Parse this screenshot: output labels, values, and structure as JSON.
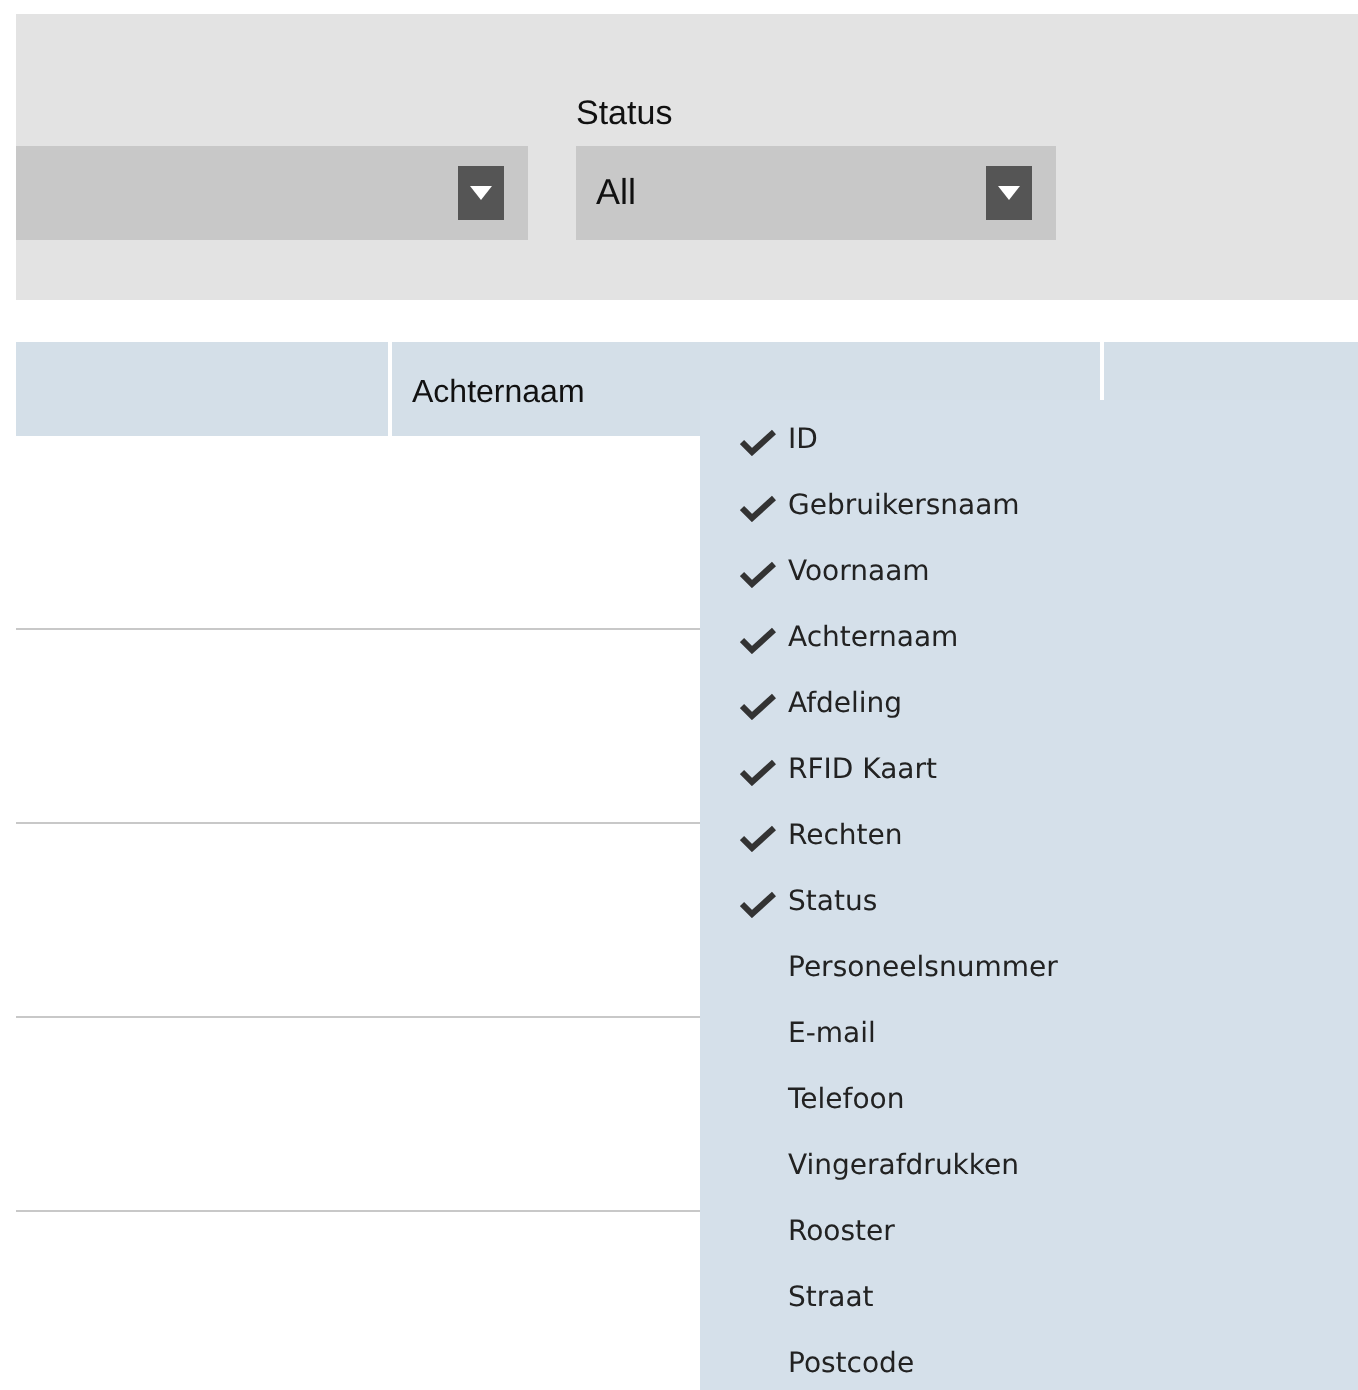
{
  "status_filter": {
    "label": "Status",
    "value": "All"
  },
  "table": {
    "columns": [
      {},
      {
        "label": "Achternaam"
      },
      {}
    ]
  },
  "column_menu": [
    {
      "label": "ID",
      "checked": true
    },
    {
      "label": "Gebruikersnaam",
      "checked": true
    },
    {
      "label": "Voornaam",
      "checked": true
    },
    {
      "label": "Achternaam",
      "checked": true
    },
    {
      "label": "Afdeling",
      "checked": true
    },
    {
      "label": "RFID Kaart",
      "checked": true
    },
    {
      "label": "Rechten",
      "checked": true
    },
    {
      "label": "Status",
      "checked": true
    },
    {
      "label": "Personeelsnummer",
      "checked": false
    },
    {
      "label": "E-mail",
      "checked": false
    },
    {
      "label": "Telefoon",
      "checked": false
    },
    {
      "label": "Vingerafdrukken",
      "checked": false
    },
    {
      "label": "Rooster",
      "checked": false
    },
    {
      "label": "Straat",
      "checked": false
    },
    {
      "label": "Postcode",
      "checked": false
    }
  ]
}
